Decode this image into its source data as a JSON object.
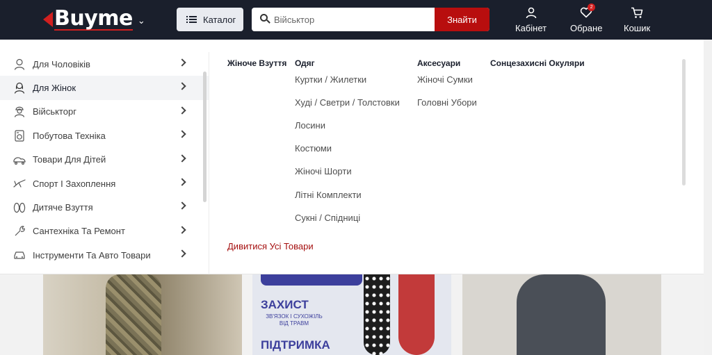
{
  "header": {
    "logo_text": "Buyme",
    "catalog_label": "Каталог",
    "search_value": "Військтор",
    "search_button": "Знайти",
    "actions": [
      {
        "label": "Кабінет",
        "icon": "user-icon"
      },
      {
        "label": "Обране",
        "icon": "heart-icon",
        "badge": "2"
      },
      {
        "label": "Кошик",
        "icon": "cart-icon"
      }
    ]
  },
  "categories": [
    {
      "label": "Для Чоловіків",
      "icon": "man-icon",
      "active": false
    },
    {
      "label": "Для Жінок",
      "icon": "woman-icon",
      "active": true
    },
    {
      "label": "Військторг",
      "icon": "soldier-icon",
      "active": false
    },
    {
      "label": "Побутова Техніка",
      "icon": "appliance-icon",
      "active": false
    },
    {
      "label": "Товари Для Дітей",
      "icon": "kids-icon",
      "active": false
    },
    {
      "label": "Спорт І Захоплення",
      "icon": "sport-icon",
      "active": false
    },
    {
      "label": "Дитяче Взуття",
      "icon": "kids-shoes-icon",
      "active": false
    },
    {
      "label": "Сантехніка Та Ремонт",
      "icon": "plumbing-icon",
      "active": false
    },
    {
      "label": "Інструменти Та Авто Товари",
      "icon": "car-tools-icon",
      "active": false
    }
  ],
  "submenu": {
    "columns": [
      {
        "title": "Жіноче Взуття",
        "links": []
      },
      {
        "title": "Одяг",
        "links": [
          "Куртки / Жилетки",
          "Худі / Светри / Толстовки",
          "Лосини",
          "Костюми",
          "Жіночі Шорти",
          "Літні Комплекти",
          "Сукні / Спідниці"
        ]
      },
      {
        "title": "Аксесуари",
        "links": [
          "Жіночі Сумки",
          "Головні Убори"
        ]
      },
      {
        "title": "Сонцезахисні Окуляри",
        "links": []
      }
    ],
    "see_all": "Дивитися Усі Товари"
  },
  "promo": {
    "banner2_line1": "ЗАХИСТ",
    "banner2_line2": "ЗВ'ЯЗОК І СУХОЖІЛЬ ВІД ТРАВМ",
    "banner2_line3": "ПІДТРИМКА"
  },
  "colors": {
    "header_bg": "#1a1f2c",
    "accent_red": "#b80e0e",
    "see_all_red": "#a50f0f"
  }
}
